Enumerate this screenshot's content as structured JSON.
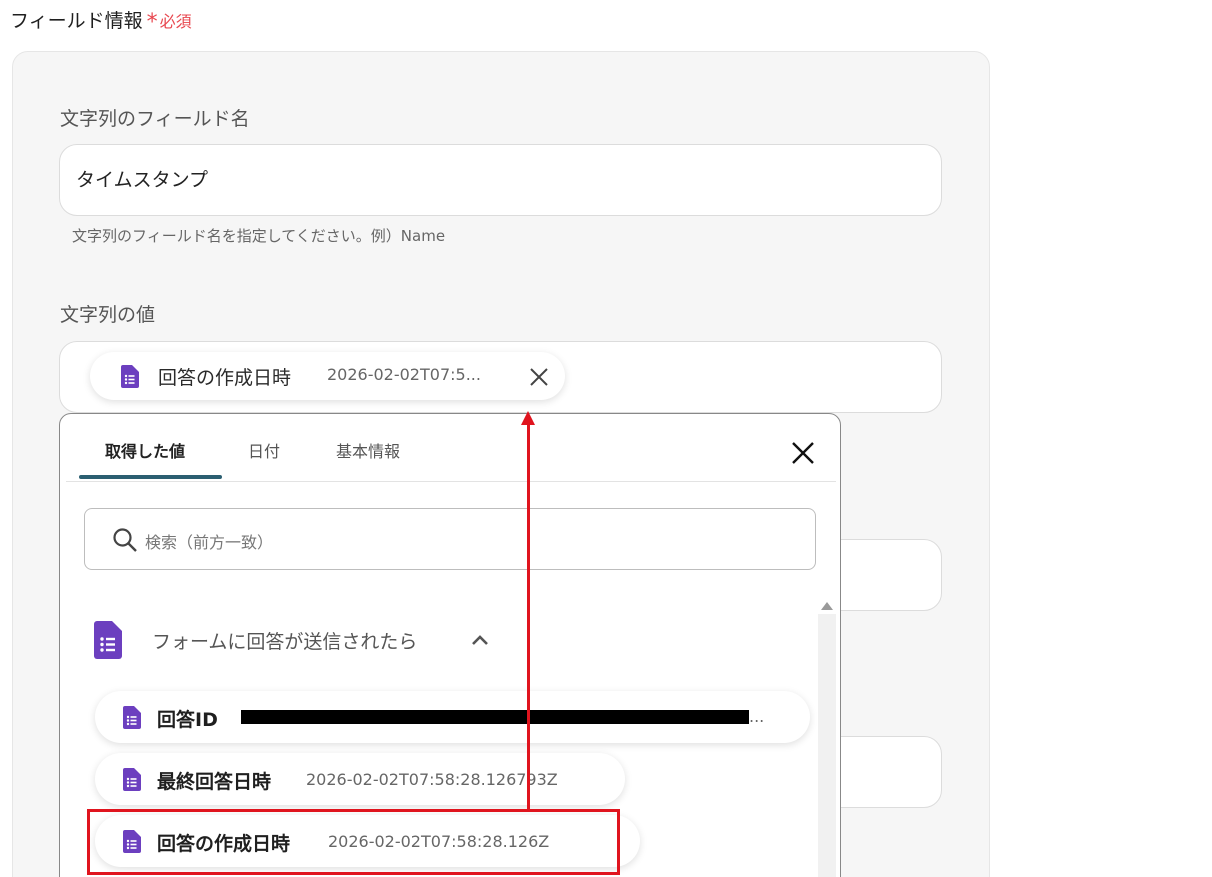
{
  "section": {
    "title": "フィールド情報",
    "required_label": "必須",
    "required_mark": "*"
  },
  "field_name": {
    "label": "文字列のフィールド名",
    "value": "タイムスタンプ",
    "hint": "文字列のフィールド名を指定してください。例）Name"
  },
  "field_value": {
    "label": "文字列の値",
    "chip": {
      "label": "回答の作成日時",
      "value": "2026-02-02T07:5...",
      "icon": "google-forms-icon"
    }
  },
  "picker": {
    "tabs": [
      {
        "label": "取得した値",
        "active": true
      },
      {
        "label": "日付",
        "active": false
      },
      {
        "label": "基本情報",
        "active": false
      }
    ],
    "search_placeholder": "検索（前方一致）",
    "group": {
      "label": "フォームに回答が送信されたら",
      "icon": "google-forms-icon",
      "expanded": true
    },
    "items": [
      {
        "label": "回答ID",
        "value": "",
        "ellipsis": "...",
        "redacted": true
      },
      {
        "label": "最終回答日時",
        "value": "2026-02-02T07:58:28.126793Z"
      },
      {
        "label": "回答の作成日時",
        "value": "2026-02-02T07:58:28.126Z"
      }
    ]
  },
  "colors": {
    "accent_underline": "#2b5f71",
    "required": "#e8474f",
    "annotation": "#e0141e",
    "forms_purple": "#6c3fbf"
  }
}
